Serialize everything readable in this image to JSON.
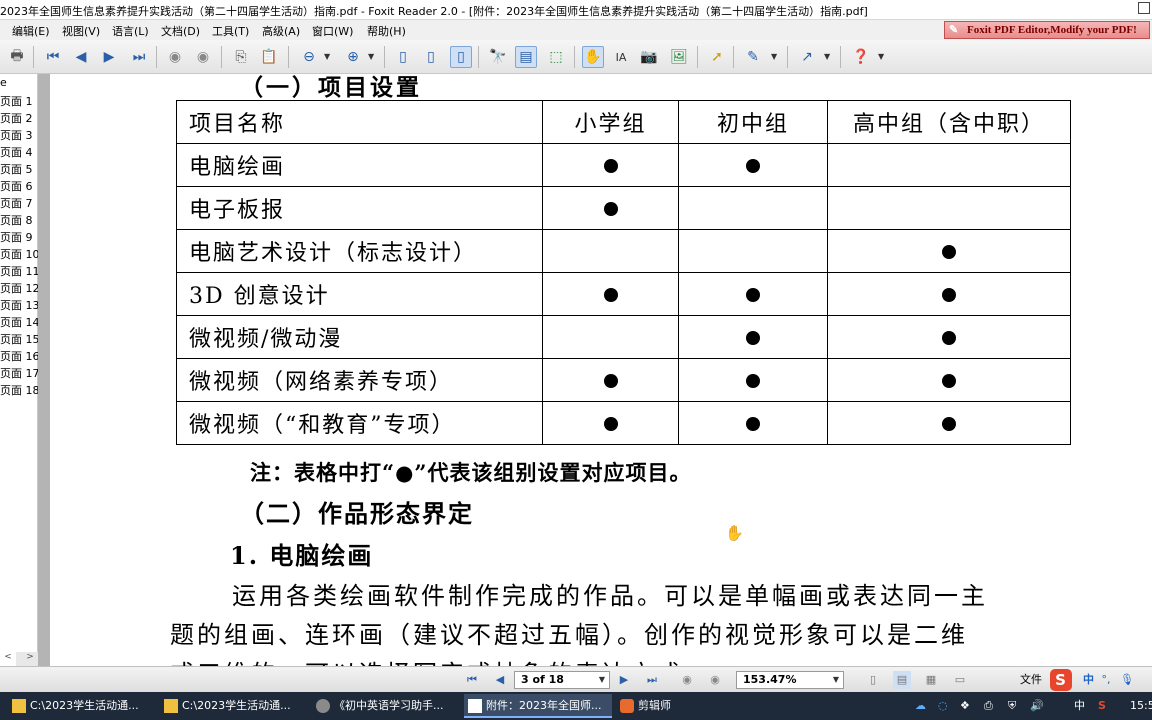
{
  "window": {
    "title": "2023年全国师生信息素养提升实践活动（第二十四届学生活动）指南.pdf - Foxit Reader 2.0 - [附件：2023年全国师生信息素养提升实践活动（第二十四届学生活动）指南.pdf]"
  },
  "menu": {
    "items": [
      "编辑(E)",
      "视图(V)",
      "语言(L)",
      "文档(D)",
      "工具(T)",
      "高级(A)",
      "窗口(W)",
      "帮助(H)"
    ],
    "ad_text": "Foxit PDF Editor,Modify your PDF!"
  },
  "toolbar": {
    "icons": [
      "print-icon",
      "first-page-icon",
      "prev-page-icon",
      "next-page-icon",
      "last-page-icon",
      "back-icon",
      "forward-icon",
      "copy-icon",
      "paste-icon",
      "zoom-out-icon",
      "zoom-in-icon",
      "single-page-icon",
      "continuous-icon",
      "facing-icon",
      "find-icon",
      "bookmark-panel-icon",
      "fit-width-icon",
      "hand-tool-icon",
      "text-select-icon",
      "snapshot-icon",
      "image-icon",
      "select-icon",
      "comment-icon",
      "arrow-tool-icon",
      "help-icon"
    ]
  },
  "sidebar": {
    "top_fragment": "e",
    "pages": [
      "页面 1",
      "页面 2",
      "页面 3",
      "页面 4",
      "页面 5",
      "页面 6",
      "页面 7",
      "页面 8",
      "页面 9",
      "页面 10",
      "页面 11",
      "页面 12",
      "页面 13",
      "页面 14",
      "页面 15",
      "页面 16",
      "页面 17",
      "页面 18"
    ],
    "scroll_left": "<",
    "scroll_right": ">"
  },
  "document": {
    "section_heading_cut": "（一）项目设置",
    "table": {
      "headers": [
        "项目名称",
        "小学组",
        "初中组",
        "高中组（含中职）"
      ],
      "rows": [
        {
          "name": "电脑绘画",
          "marks": [
            true,
            true,
            false
          ]
        },
        {
          "name": "电子板报",
          "marks": [
            true,
            false,
            false
          ]
        },
        {
          "name": "电脑艺术设计（标志设计）",
          "marks": [
            false,
            false,
            true
          ]
        },
        {
          "name": "3D 创意设计",
          "marks": [
            true,
            true,
            true
          ]
        },
        {
          "name": "微视频/微动漫",
          "marks": [
            false,
            true,
            true
          ]
        },
        {
          "name": "微视频（网络素养专项）",
          "marks": [
            true,
            true,
            true
          ]
        },
        {
          "name": "微视频（“和教育”专项）",
          "marks": [
            true,
            true,
            true
          ]
        }
      ]
    },
    "note": "注：表格中打“●”代表该组别设置对应项目。",
    "section2": "（二）作品形态界定",
    "subsection1": "1. 电脑绘画",
    "para_line1": "运用各类绘画软件制作完成的作品。可以是单幅画或表达同一主",
    "para_line2": "题的组画、连环画（建议不超过五幅）。创作的视觉形象可以是二维",
    "para_line3": "或三维的，可以选择写实或抽象的表达方式。"
  },
  "navbar": {
    "page_display": "3 of 18",
    "zoom": "153.47%",
    "ime_label": "文件",
    "ime_logo": "S",
    "ime_lang": "中",
    "ime_punct": "°,"
  },
  "taskbar": {
    "tasks": [
      {
        "label": "C:\\2023学生活动通...",
        "icon": "folder-icon"
      },
      {
        "label": "C:\\2023学生活动通...",
        "icon": "folder-icon"
      },
      {
        "label": "《初中英语学习助手...",
        "icon": "browser-icon"
      },
      {
        "label": "附件：2023年全国师...",
        "icon": "pdf-icon"
      },
      {
        "label": "剪辑师",
        "icon": "editor-icon"
      }
    ],
    "tray_lang": "中",
    "clock": "15:5"
  }
}
